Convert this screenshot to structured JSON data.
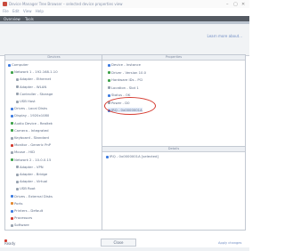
{
  "window": {
    "title": "Device Manager Tree Browser – selected device properties view",
    "controls": [
      "–",
      "▢",
      "✕"
    ]
  },
  "menubar": [
    "File",
    "Edit",
    "View",
    "Help"
  ],
  "toolbar": {
    "tabs": [
      "Overview",
      "Tools"
    ]
  },
  "header": {
    "link": "Learn more about..."
  },
  "left_panel": {
    "title": "Devices",
    "items": [
      {
        "label": "Computer",
        "icon": "blue"
      },
      {
        "label": "Network 1 - 192.168.1.10",
        "icon": "grn"
      },
      {
        "label": "Adapter - Ethernet",
        "icon": "gry"
      },
      {
        "label": "Adapter - WLAN",
        "icon": "gry"
      },
      {
        "label": "Controller - Storage",
        "icon": "gry"
      },
      {
        "label": "USB Host",
        "icon": "gry"
      },
      {
        "label": "Drives - Local Disks",
        "icon": "blue"
      },
      {
        "label": "Display - 1920x1080",
        "icon": "blue"
      },
      {
        "label": "Audio Device - Realtek",
        "icon": "grn"
      },
      {
        "label": "Camera - Integrated",
        "icon": "grn"
      },
      {
        "label": "Keyboard - Standard",
        "icon": "gry"
      },
      {
        "label": "Monitor - Generic PnP",
        "icon": "red"
      },
      {
        "label": "Mouse - HID",
        "icon": "gry"
      },
      {
        "label": "Network 2 - 10.0.0.15",
        "icon": "grn"
      },
      {
        "label": "Adapter - VPN",
        "icon": "gry"
      },
      {
        "label": "Adapter - Bridge",
        "icon": "gry"
      },
      {
        "label": "Adapter - Virtual",
        "icon": "gry"
      },
      {
        "label": "USB Root",
        "icon": "gry"
      },
      {
        "label": "Drives - External Disks",
        "icon": "blue"
      },
      {
        "label": "Ports",
        "icon": "org"
      },
      {
        "label": "Printers - Default",
        "icon": "blue"
      },
      {
        "label": "Processors",
        "icon": "red"
      },
      {
        "label": "Software",
        "icon": "gry"
      }
    ]
  },
  "right_top": {
    "title": "Properties",
    "items": [
      {
        "label": "Device - Instance",
        "icon": "blue"
      },
      {
        "label": "Driver - Version 10.0",
        "icon": "grn"
      },
      {
        "label": "Hardware IDs - PCI",
        "icon": "grn"
      },
      {
        "label": "Location - Slot 1",
        "icon": "gry"
      },
      {
        "label": "Status - OK",
        "icon": "blue"
      },
      {
        "label": "Power - D0",
        "icon": "gry"
      },
      {
        "label": "IRQ - 0x0000001A",
        "icon": "blue"
      }
    ],
    "highlight_index": 6
  },
  "right_bottom": {
    "title": "Details",
    "items": [
      {
        "label": "IRQ - 0x0000001A [selected]",
        "icon": "blue"
      }
    ]
  },
  "bottom": {
    "left_label": "Ready",
    "center_button": "Close",
    "right_link": "Apply changes"
  }
}
